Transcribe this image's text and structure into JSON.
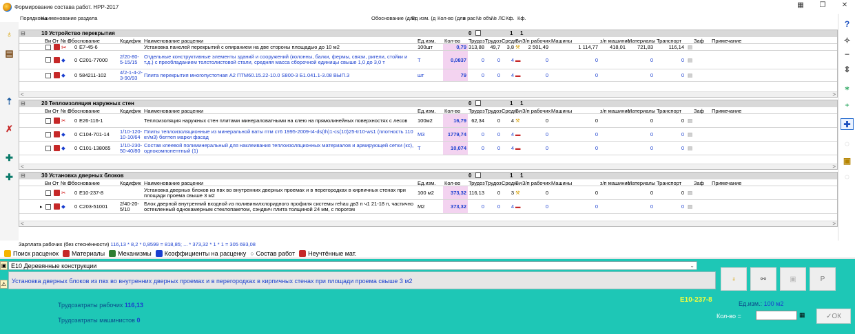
{
  "window": {
    "title": "Формирование состава работ. НРР-2017",
    "icons": [
      "app-icon",
      "tile-icon",
      "restore-icon",
      "close-icon"
    ]
  },
  "header_cols": [
    "Порядковы",
    "Наименование раздела",
    "Обоснование (для",
    "Ед изм. (д",
    "Кол-во (для",
    "в рас",
    "№ объ",
    "№ ЛС",
    "Кф.",
    "Кф."
  ],
  "grid_cols": [
    "Ви",
    "От",
    "№ п",
    "Обоснование",
    "Кодифик",
    "Наименование расценки",
    "Ед.изм.",
    "Кол-во",
    "Трудоз",
    "Трудоз",
    "Средн",
    "Ви",
    "З/п рабочих",
    "Машины",
    "з/п машинис",
    "Материалы",
    "Транспорт",
    "Заф",
    "Примечание"
  ],
  "sections": [
    {
      "title": "10 Устройство перекрытия",
      "num": "0",
      "flag": "1",
      "k1": "1",
      "rows": [
        {
          "n": "0",
          "code": "Е7-45-6",
          "kod": "",
          "name": "Установка панелей перекрытий с опиранием на две стороны площадью до 10 м2",
          "unit": "100шт",
          "qty": "0,79",
          "t1": "313,88",
          "t2": "49,7",
          "sr": "3,8",
          "zp": "2 501,49",
          "mash": "1 114,77",
          "zpm": "418,01",
          "mat": "721,83",
          "tr": "116,14",
          "blue": false
        },
        {
          "n": "0",
          "code": "С201-77000",
          "kod": "2/20-80-5-15/15",
          "name": "Отдельные конструктивные элементы зданий и сооружений (колонны, балки, фермы, связи, ригели, стойки и т.д.) с преобладанием толстолистовой стали, средняя масса сборочной единицы свыше 1,0 до 3,0 т",
          "unit": "Т",
          "qty": "0,0837",
          "t1": "0",
          "t2": "0",
          "sr": "4",
          "zp": "0",
          "mash": "0",
          "zpm": "",
          "mat": "0",
          "tr": "0",
          "blue": true
        },
        {
          "n": "0",
          "code": "584211-102",
          "kod": "4/2-1-4-2-3-90/93",
          "name": "Плита перекрытия многопустотная А2 ПТМ60.15.22-10.0 S800-3 Б1.041.1-3.08 ВЫП.3",
          "unit": "шт",
          "qty": "79",
          "t1": "0",
          "t2": "0",
          "sr": "4",
          "zp": "0",
          "mash": "0",
          "zpm": "",
          "mat": "0",
          "tr": "0",
          "blue": true
        }
      ]
    },
    {
      "title": "20 Теплоизоляция наружных стен",
      "num": "0",
      "flag": "1",
      "k1": "1",
      "rows": [
        {
          "n": "0",
          "code": "Е26-116-1",
          "kod": "",
          "name": "Теплоизоляция наружных стен плитами минераловатными на клею на прямолинейных поверхностях с лесов",
          "unit": "100м2",
          "qty": "16,79",
          "t1": "62,34",
          "t2": "0",
          "sr": "4",
          "zp": "0",
          "mash": "0",
          "zpm": "",
          "mat": "0",
          "tr": "0",
          "blue": false
        },
        {
          "n": "0",
          "code": "С104-701-14",
          "kod": "1/10-120-10-10/64",
          "name": "Плиты теплоизоляционные из минеральной ваты птм ст6 1995-2009-t4-ds(th)1-cs(10)25-tr10-ws1 (плотность 110 кг/м3) белтеп марки фасад",
          "unit": "М3",
          "qty": "1779,74",
          "t1": "0",
          "t2": "0",
          "sr": "4",
          "zp": "0",
          "mash": "0",
          "zpm": "",
          "mat": "0",
          "tr": "0",
          "blue": true
        },
        {
          "n": "0",
          "code": "С101-138065",
          "kod": "1/10-230-50-40/80",
          "name": "Состав клеевой полиминеральный для наклеивания теплоизоляционных материалов и армирующей сетки (кс), однокомпонентный (1)",
          "unit": "Т",
          "qty": "10,074",
          "t1": "0",
          "t2": "0",
          "sr": "4",
          "zp": "0",
          "mash": "0",
          "zpm": "",
          "mat": "0",
          "tr": "0",
          "blue": true
        }
      ]
    },
    {
      "title": "30 Установка дверных блоков",
      "num": "0",
      "flag": "1",
      "k1": "1",
      "rows": [
        {
          "n": "0",
          "code": "Е10-237-8",
          "kod": "",
          "name": "Установка дверных блоков из пвх во внутренних дверных проемах и в перегородках в кирпичных стенах при площади проема свыше 3 м2",
          "unit": "100 м2",
          "qty": "373,32",
          "t1": "116,13",
          "t2": "0",
          "sr": "3",
          "zp": "0",
          "mash": "0",
          "zpm": "",
          "mat": "0",
          "tr": "0",
          "blue": false
        },
        {
          "n": "0",
          "code": "С203-51001",
          "kod": "2/40-20-5/10",
          "name": "Блок дверной внутренний входной из поливинилхлоридного профиля системы rehau дв3 п ч1 21-18 п, частично остекленный однокамерным стеклопакетом, сэндвич плита толщиной 24 мм, с порогом",
          "unit": "М2",
          "qty": "373,32",
          "t1": "0",
          "t2": "0",
          "sr": "4",
          "zp": "0",
          "mash": "0",
          "zpm": "",
          "mat": "0",
          "tr": "0",
          "blue": false
        }
      ]
    }
  ],
  "salary": {
    "label": "Зарплата рабочих (без стеснённости)",
    "formula": "116,13 * 8,2 * 0,8599 =      818,85;  ... * 373,32 * 1 * 1 =  305 693,08"
  },
  "tabs": [
    "Поиск расценок",
    "Материалы",
    "Механизмы",
    "Коэффициенты на расценку",
    "Состав работ",
    "Неучтённые мат."
  ],
  "bottom": {
    "category": "Е10  Деревянные конструкции",
    "description": "Установка дверных блоков из пвх во внутренних дверных проемах и в перегородках в кирпичных стенах при площади проема свыше 3 м2",
    "labor_workers_label": "Трудозатраты рабочих",
    "labor_workers_value": "116,13",
    "labor_mach_label": "Трудозатраты машинистов",
    "labor_mach_value": "0",
    "code": "Е10-237-8",
    "unit_label": "Ед.изм.:",
    "unit_value": "100 м2",
    "qty_label": "Кол-во =",
    "ok_label": "ОК",
    "p_label": "Р"
  }
}
